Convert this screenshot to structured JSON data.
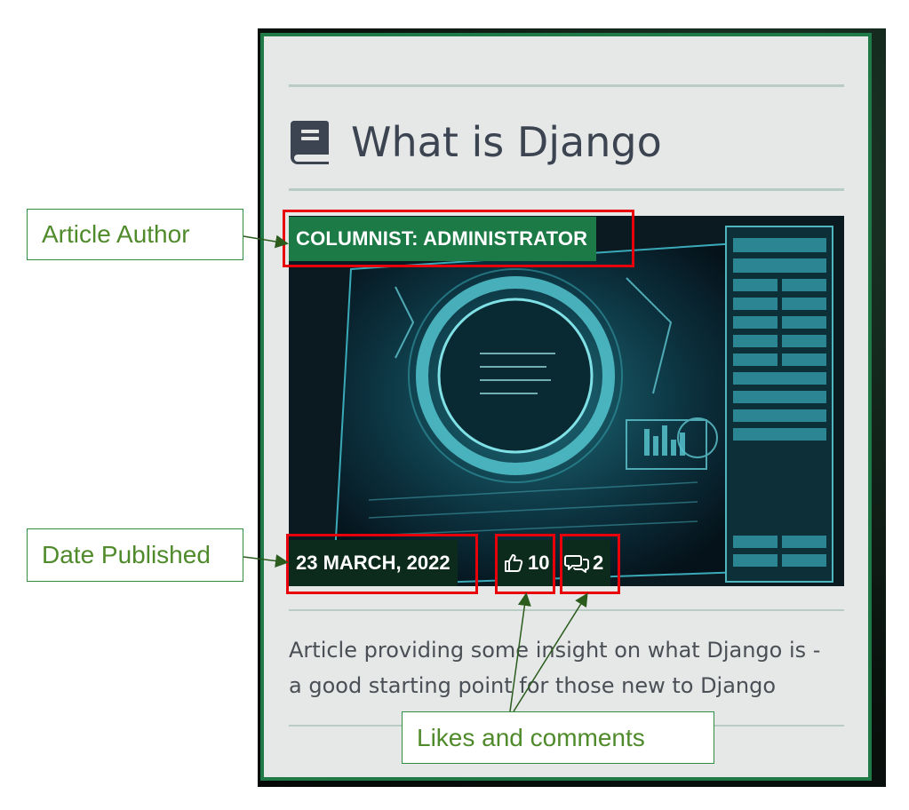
{
  "article": {
    "title": "What is Django",
    "author_badge": "COLUMNIST: ADMINISTRATOR",
    "date": "23 MARCH, 2022",
    "likes": "10",
    "comments": "2",
    "description": "Article providing some insight on what Django is - a good starting point for those new to Django"
  },
  "icons": {
    "title": "book-icon",
    "likes": "thumbs-up-icon",
    "comments": "comments-icon"
  },
  "annotations": {
    "author": "Article Author",
    "date": "Date Published",
    "likes_comments": "Likes and comments"
  },
  "colors": {
    "card_border": "#1f7a48",
    "author_badge": "#1b7a45",
    "date_badge": "#0d2b1c",
    "highlight": "#e8000b",
    "callout_text": "#4f8a2b"
  }
}
